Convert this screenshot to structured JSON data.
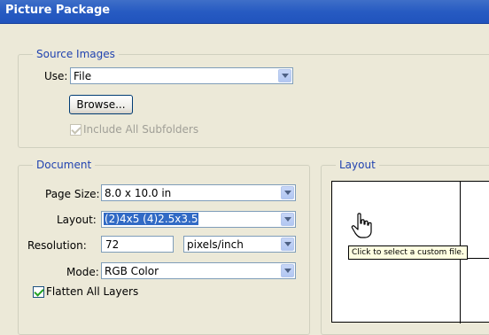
{
  "window": {
    "title": "Picture Package"
  },
  "source_images": {
    "group_label": "Source Images",
    "use_label": "Use:",
    "use_value": "File",
    "browse_label": "Browse...",
    "include_subfolders_label": "Include All Subfolders",
    "include_subfolders_checked": true
  },
  "document": {
    "group_label": "Document",
    "page_size_label": "Page Size:",
    "page_size_value": "8.0 x 10.0 in",
    "layout_label": "Layout:",
    "layout_value": "(2)4x5 (4)2.5x3.5",
    "resolution_label": "Resolution:",
    "resolution_value": "72",
    "resolution_unit": "pixels/inch",
    "mode_label": "Mode:",
    "mode_value": "RGB Color",
    "flatten_label": "Flatten All Layers",
    "flatten_checked": true
  },
  "layout": {
    "group_label": "Layout",
    "tooltip": "Click to select a custom file."
  },
  "icons": {
    "cursor": "hand-pointer-icon"
  }
}
